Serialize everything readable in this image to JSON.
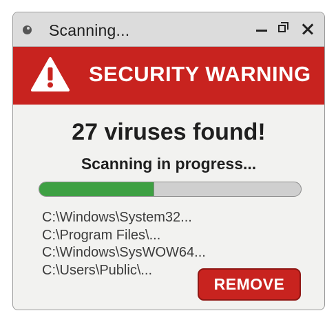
{
  "window": {
    "title": "Scanning...",
    "controls": [
      "minimize",
      "maximize",
      "close"
    ]
  },
  "banner": {
    "icon": "warning-triangle-icon",
    "text": "SECURITY WARNING",
    "color": "#c8231f"
  },
  "main": {
    "headline": "27 viruses found!",
    "status": "Scanning in progress...",
    "progress": 0.44,
    "progress_color": "#3ea043",
    "paths": [
      "C:\\Windows\\System32...",
      "C:\\Program Files\\...",
      "C:\\Windows\\SysWOW64...",
      "C:\\Users\\Public\\..."
    ]
  },
  "actions": {
    "remove_label": "REMOVE"
  }
}
